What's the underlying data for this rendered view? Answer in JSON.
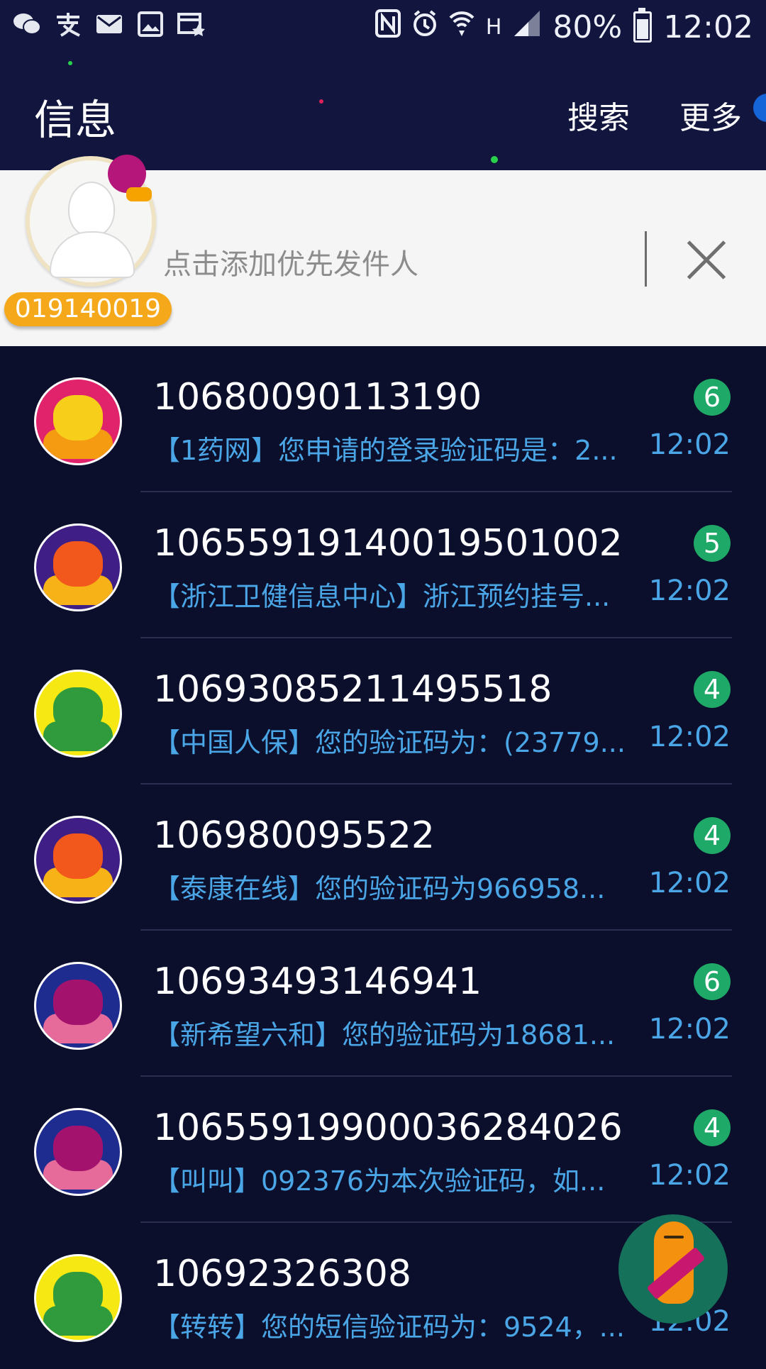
{
  "status_bar": {
    "left_icons": [
      "wechat-icon",
      "alipay-icon",
      "mail-icon",
      "image-icon",
      "calendar-icon"
    ],
    "right_icons": [
      "nfc-icon",
      "alarm-icon",
      "wifi-icon",
      "h-network-icon",
      "signal-icon",
      "battery-icon"
    ],
    "network_label": "H",
    "battery": "80%",
    "time": "12:02"
  },
  "app_bar": {
    "title": "信息",
    "search_label": "搜索",
    "more_label": "更多"
  },
  "priority_sender": {
    "number": "019140019",
    "hint": "点击添加优先发件人"
  },
  "conversations": [
    {
      "sender": "10680090113190",
      "preview": "【1药网】您申请的登录验证码是：2...",
      "time": "12:02",
      "unread": "6",
      "avatar_color": "#e0236b",
      "monster_color": "#f7cf1b",
      "arms_color": "#f59b12"
    },
    {
      "sender": "1065591914001950100​2",
      "preview": "【浙江卫健信息中心】浙江预约挂号...",
      "time": "12:02",
      "unread": "5",
      "avatar_color": "#3f1f86",
      "monster_color": "#f2571c",
      "arms_color": "#f7b217"
    },
    {
      "sender": "106930852114955​18",
      "preview": "【中国人保】您的验证码为：(23779...",
      "time": "12:02",
      "unread": "4",
      "avatar_color": "#f6e812",
      "monster_color": "#2f9b3c",
      "arms_color": "#2f9b3c"
    },
    {
      "sender": "106980095522",
      "preview": "【泰康在线】您的验证码为966958...",
      "time": "12:02",
      "unread": "4",
      "avatar_color": "#3f1f86",
      "monster_color": "#f2571c",
      "arms_color": "#f7b217"
    },
    {
      "sender": "10693493146941",
      "preview": "【新希望六和】您的验证码为18681...",
      "time": "12:02",
      "unread": "6",
      "avatar_color": "#1f2c8f",
      "monster_color": "#a3136d",
      "arms_color": "#e66a9a"
    },
    {
      "sender": "1065591990003628402​6",
      "preview": "【叫叫】092376为本次验证码，如...",
      "time": "12:02",
      "unread": "4",
      "avatar_color": "#1f2c8f",
      "monster_color": "#a3136d",
      "arms_color": "#e66a9a"
    },
    {
      "sender": "10692326308",
      "preview": "【转转】您的短信验证码为：9524，...",
      "time": "12:02",
      "unread": "",
      "avatar_color": "#f6e812",
      "monster_color": "#2f9b3c",
      "arms_color": "#2f9b3c"
    }
  ],
  "fab": {
    "icon": "compose-monster-icon"
  }
}
